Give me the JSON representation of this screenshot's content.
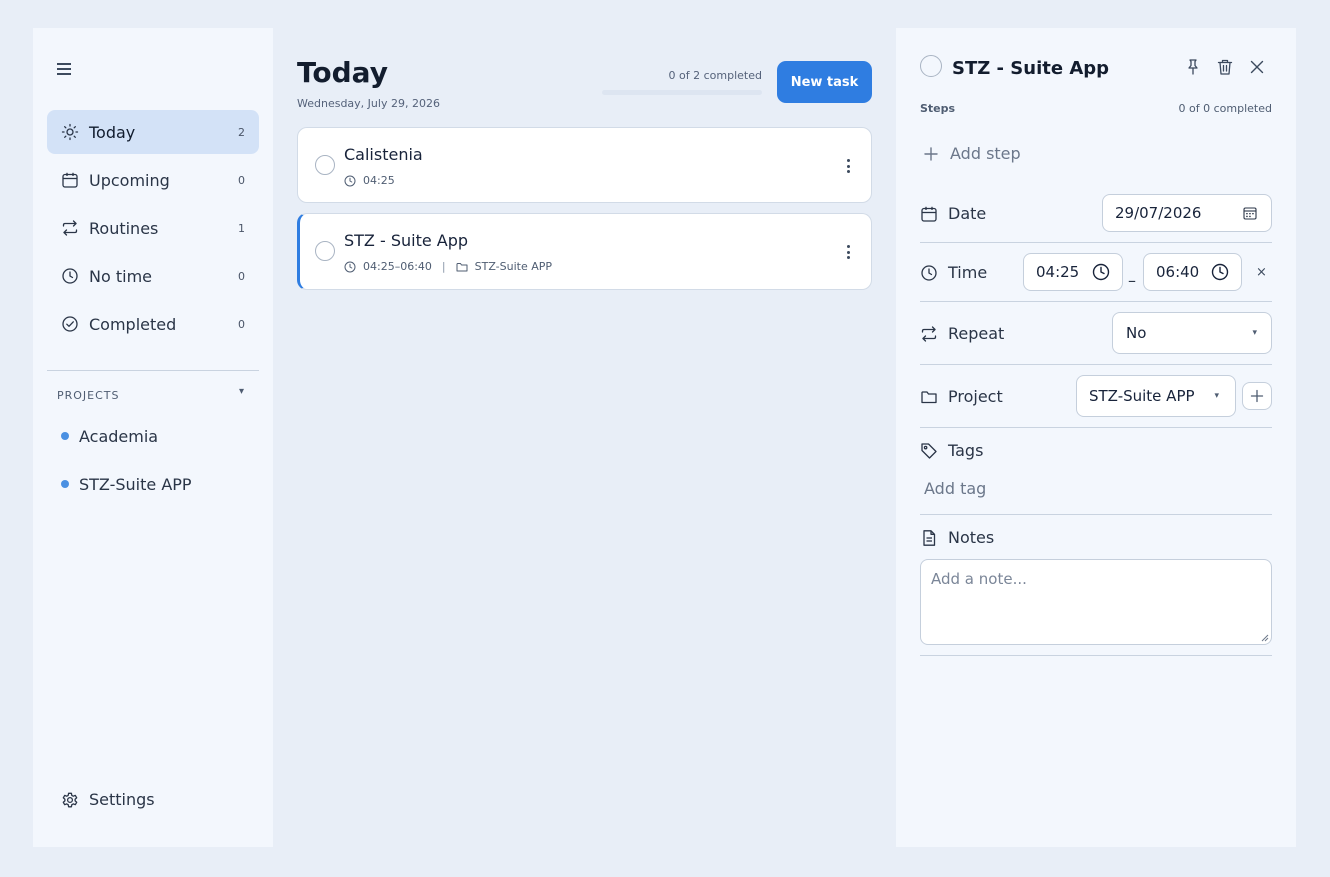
{
  "sidebar": {
    "items": [
      {
        "label": "Today",
        "count": "2"
      },
      {
        "label": "Upcoming",
        "count": "0"
      },
      {
        "label": "Routines",
        "count": "1"
      },
      {
        "label": "No time",
        "count": "0"
      },
      {
        "label": "Completed",
        "count": "0"
      }
    ],
    "projects_header": "PROJECTS",
    "projects": [
      {
        "label": "Academia",
        "color": "#4a90e2"
      },
      {
        "label": "STZ-Suite APP",
        "color": "#4a90e2"
      }
    ],
    "settings_label": "Settings"
  },
  "main": {
    "title": "Today",
    "date": "Wednesday, July 29, 2026",
    "progress_text": "0 of 2 completed",
    "progress_fraction": 0,
    "new_task_label": "New task",
    "tasks": [
      {
        "title": "Calistenia",
        "time": "04:25",
        "project": ""
      },
      {
        "title": "STZ - Suite App",
        "time": "04:25–06:40",
        "project": "STZ-Suite APP"
      }
    ]
  },
  "detail": {
    "title": "STZ - Suite App",
    "steps_label": "Steps",
    "steps_count": "0 of 0 completed",
    "add_step_label": "Add step",
    "date_label": "Date",
    "date_value": "29/07/2026",
    "time_label": "Time",
    "time_start": "04:25",
    "time_dash": "–",
    "time_end": "06:40",
    "time_clear": "×",
    "repeat_label": "Repeat",
    "repeat_value": "No",
    "project_label": "Project",
    "project_value": "STZ-Suite APP",
    "tags_label": "Tags",
    "add_tag_label": "Add tag",
    "notes_label": "Notes",
    "notes_placeholder": "Add a note..."
  },
  "colors": {
    "accent": "#2f7de1",
    "active_nav_bg": "#d3e2f7",
    "project_dot": "#4a90e2"
  }
}
